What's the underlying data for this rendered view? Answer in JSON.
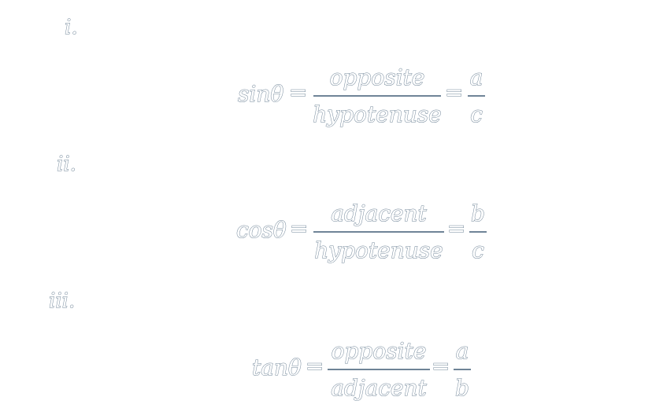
{
  "items": [
    {
      "label": "i.",
      "lhs": "sinθ",
      "equals": "=",
      "ratio_numerator": "opposite",
      "ratio_denominator": "hypotenuse",
      "equals2": "=",
      "side_numerator": "a",
      "side_denominator": "c"
    },
    {
      "label": "ii.",
      "lhs": "cosθ",
      "equals": "=",
      "ratio_numerator": "adjacent",
      "ratio_denominator": "hypotenuse",
      "equals2": "=",
      "side_numerator": "b",
      "side_denominator": "c"
    },
    {
      "label": "iii.",
      "lhs": "tanθ",
      "equals": "=",
      "ratio_numerator": "opposite",
      "ratio_denominator": "adjacent",
      "equals2": "=",
      "side_numerator": "a",
      "side_denominator": "b"
    }
  ]
}
